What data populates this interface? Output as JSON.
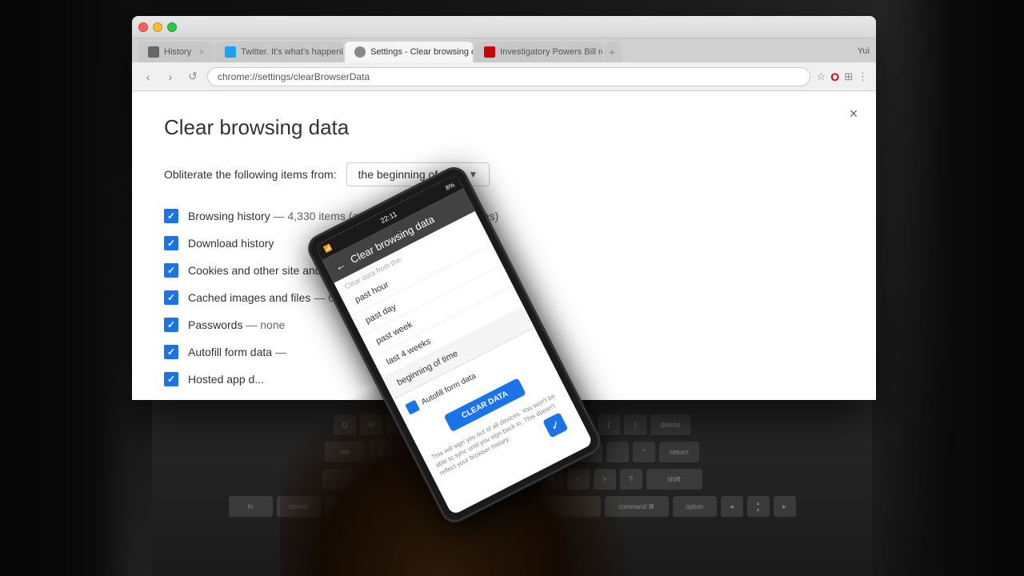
{
  "browser": {
    "url": "chrome://settings/clearBrowserData",
    "tabs": [
      {
        "label": "History",
        "active": false
      },
      {
        "label": "Twitter. It's what's happening.",
        "active": false
      },
      {
        "label": "Settings - Clear browsing data",
        "active": true
      },
      {
        "label": "Investigatory Powers Bill rece...",
        "active": false
      }
    ],
    "username": "Yui"
  },
  "dialog": {
    "title": "Clear browsing data",
    "close_label": "×",
    "obliterate_label": "Obliterate the following items from:",
    "time_dropdown": {
      "selected": "the beginning of time",
      "options": [
        "past hour",
        "past day",
        "past week",
        "last 4 weeks",
        "the beginning of time"
      ]
    },
    "checkboxes": [
      {
        "label": "Browsing history",
        "detail": " — 4,330 items (and more on synced devices)",
        "checked": true
      },
      {
        "label": "Download history",
        "detail": "",
        "checked": true
      },
      {
        "label": "Cookies and other site and plugin data",
        "detail": "",
        "checked": true
      },
      {
        "label": "Cached images and files",
        "detail": " — 638 MB",
        "checked": true
      },
      {
        "label": "Passwords",
        "detail": " — none",
        "checked": true
      },
      {
        "label": "Autofill form data",
        "detail": " —",
        "checked": true
      },
      {
        "label": "Hosted app d...",
        "detail": "",
        "checked": true
      }
    ]
  },
  "phone": {
    "title": "Clear browsing data",
    "clear_label": "Clear data from the:",
    "dropdown_options": [
      "past hour",
      "past day",
      "past week",
      "last 4 weeks",
      "beginning of time"
    ],
    "selected_option": "beginning of time",
    "checkboxes": [
      "Autofill form data"
    ],
    "clear_btn_label": "CLEAR DATA",
    "bottom_text": "This will sign you out of all devices. You won't be able to sync until you sign back in. This doesn't reflect your browser history.",
    "time": "22:11",
    "battery": "8%"
  },
  "nav": {
    "back": "‹",
    "forward": "›",
    "reload": "↺",
    "star": "☆",
    "opera": "O",
    "extensions": "⊞",
    "menu": "⋮"
  }
}
